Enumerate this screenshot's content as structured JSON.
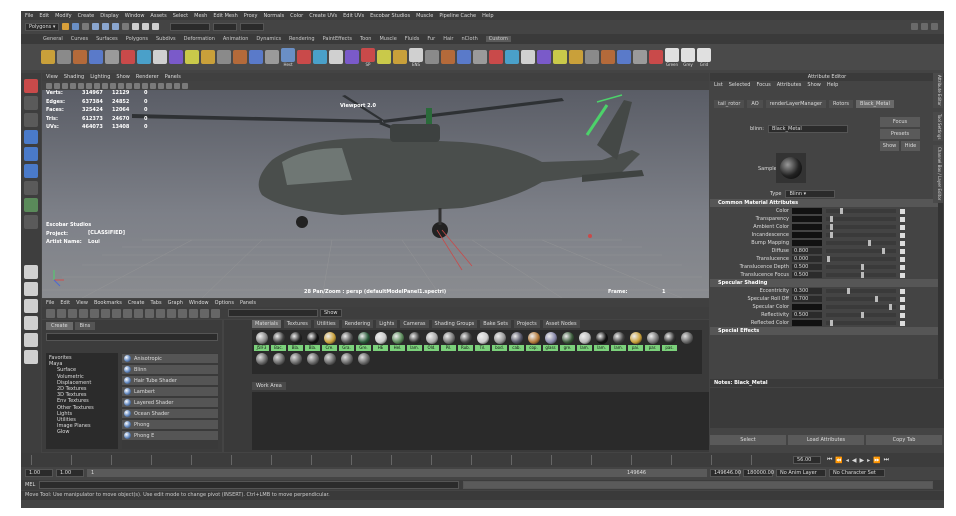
{
  "menubar": [
    "File",
    "Edit",
    "Modify",
    "Create",
    "Display",
    "Window",
    "Assets",
    "Select",
    "Mesh",
    "Edit Mesh",
    "Proxy",
    "Normals",
    "Color",
    "Create UVs",
    "Edit UVs",
    "Escobar Studios",
    "Muscle",
    "Pipeline Cache",
    "Help"
  ],
  "status_line": {
    "mode": "Polygons"
  },
  "shelf_tabs": [
    "General",
    "Curves",
    "Surfaces",
    "Polygons",
    "Subdivs",
    "Deformation",
    "Animation",
    "Dynamics",
    "Rendering",
    "PaintEffects",
    "Toon",
    "Muscle",
    "Fluids",
    "Fur",
    "Hair",
    "nCloth",
    "Custom"
  ],
  "shelf_active_tab": "Custom",
  "shelf_labels": [
    "Hest",
    "SP",
    "ENS",
    "Green",
    "Grey",
    "Grid"
  ],
  "viewport": {
    "menu": [
      "View",
      "Shading",
      "Lighting",
      "Show",
      "Renderer",
      "Panels"
    ],
    "hud_labels": [
      "Verts:",
      "Edges:",
      "Faces:",
      "Tris:",
      "UVs:"
    ],
    "hud_values": [
      "314967",
      "637384",
      "325424",
      "612373",
      "464073"
    ],
    "hud_values2": [
      "12129",
      "24852",
      "12064",
      "24670",
      "13408"
    ],
    "hud_values3": [
      "0",
      "0",
      "0",
      "0",
      "0"
    ],
    "studio_labels": [
      "Escobar Studios",
      "Project:",
      "Artist Name:"
    ],
    "studio_values": [
      "",
      "[CLASSIFIED]",
      "Loui"
    ],
    "title": "Viewport 2.0",
    "camera": "28 Pan/Zoom : persp (defaultModelPanel1.spectri)",
    "frame_label": "Frame:",
    "frame_value": "1"
  },
  "hypershade": {
    "menu": [
      "File",
      "Edit",
      "View",
      "Bookmarks",
      "Create",
      "Tabs",
      "Graph",
      "Window",
      "Options",
      "Panels"
    ],
    "show_label": "Show",
    "left_tabs": [
      "Create",
      "Bins"
    ],
    "tree": [
      "Favorites",
      "Maya",
      "Surface",
      "Volumetric",
      "Displacement",
      "2D Textures",
      "3D Textures",
      "Env Textures",
      "Other Textures",
      "Lights",
      "Utilities",
      "Image Planes",
      "Glow"
    ],
    "shaders": [
      "Anisotropic",
      "Blinn",
      "Hair Tube Shader",
      "Lambert",
      "Layered Shader",
      "Ocean Shader",
      "Phong",
      "Phong E"
    ],
    "mat_tabs": [
      "Materials",
      "Textures",
      "Utilities",
      "Rendering",
      "Lights",
      "Cameras",
      "Shading Groups",
      "Bake Sets",
      "Projects",
      "Asset Nodes"
    ],
    "materials": [
      "J5IF3",
      "Bac.",
      "Bla.",
      "Bla.",
      "Cre.",
      "Gra.",
      "Gre.",
      "HE",
      "Hel.",
      "lam.",
      "Old.",
      "Pil.",
      "Rub.",
      "Til.",
      "bod.",
      "cab.",
      "cop.",
      "glass",
      "gre.",
      "lam.",
      "lam.",
      "lam.",
      "pai.",
      "par.",
      "pas."
    ],
    "work_area": "Work Area"
  },
  "attribute_editor": {
    "title": "Attribute Editor",
    "menu": [
      "List",
      "Selected",
      "Focus",
      "Attributes",
      "Show",
      "Help"
    ],
    "tabs": [
      "tail_rotor",
      "AO",
      "renderLayerManager",
      "Rotors",
      "Black_Metal"
    ],
    "blinn_label": "blinn:",
    "blinn_value": "Black_Metal",
    "focus": "Focus",
    "presets": "Presets",
    "show": "Show",
    "hide": "Hide",
    "sample": "Sample",
    "type_label": "Type",
    "type_value": "Blinn",
    "sections": [
      "Common Material Attributes",
      "Specular Shading",
      "Special Effects"
    ],
    "common_attrs": [
      {
        "label": "Color",
        "value": ""
      },
      {
        "label": "Transparency",
        "value": ""
      },
      {
        "label": "Ambient Color",
        "value": ""
      },
      {
        "label": "Incandescence",
        "value": ""
      },
      {
        "label": "Bump Mapping",
        "value": ""
      },
      {
        "label": "Diffuse",
        "value": "0.800"
      },
      {
        "label": "Translucence",
        "value": "0.000"
      },
      {
        "label": "Translucence Depth",
        "value": "0.500"
      },
      {
        "label": "Translucence Focus",
        "value": "0.500"
      }
    ],
    "specular_attrs": [
      {
        "label": "Eccentricity",
        "value": "0.300"
      },
      {
        "label": "Specular Roll Off",
        "value": "0.700"
      },
      {
        "label": "Specular Color",
        "value": ""
      },
      {
        "label": "Reflectivity",
        "value": "0.500"
      },
      {
        "label": "Reflected Color",
        "value": ""
      }
    ],
    "notes": "Notes: Black_Metal",
    "buttons": [
      "Select",
      "Load Attributes",
      "Copy Tab"
    ]
  },
  "side_tabs": [
    "Attribute Editor",
    "Tool Settings",
    "Channel Box / Layer Editor"
  ],
  "timeline": {
    "current": "56.00"
  },
  "range": {
    "start": "1.00",
    "start2": "1.00",
    "marker": "1",
    "end_label": "149646",
    "end": "149646.00",
    "end2": "180000.00",
    "anim_layer": "No Anim Layer",
    "char_set": "No Character Set"
  },
  "cmd_label": "MEL",
  "help_line": "Move Tool: Use manipulator to move object(s). Use edit mode to change pivot (INSERT). Ctrl+LMB to move perpendicular."
}
